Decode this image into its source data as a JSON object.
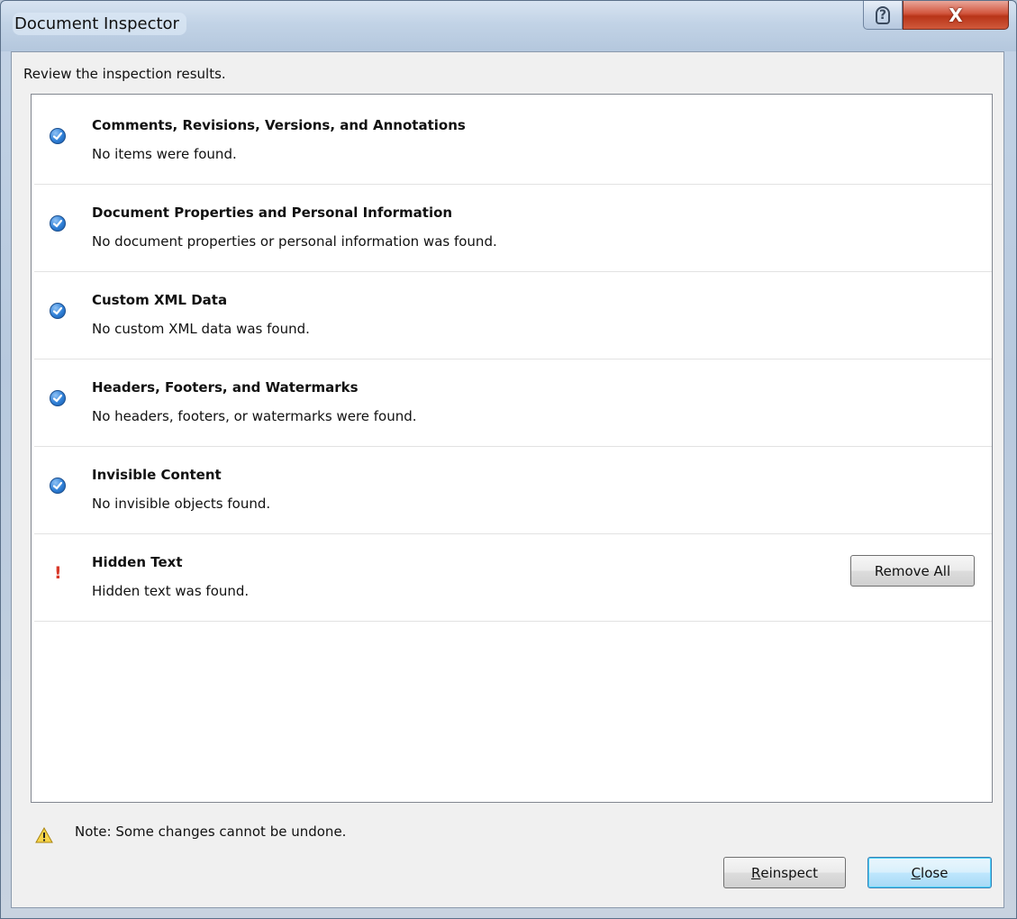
{
  "window": {
    "title": "Document Inspector",
    "help_glyph": "?",
    "close_glyph": "X"
  },
  "review_label": "Review the inspection results.",
  "results": [
    {
      "title": "Comments, Revisions, Versions, and Annotations",
      "description": "No items were found.",
      "status": "ok",
      "icon": "check-icon"
    },
    {
      "title": "Document Properties and Personal Information",
      "description": "No document properties or personal information was found.",
      "status": "ok",
      "icon": "check-icon"
    },
    {
      "title": "Custom XML Data",
      "description": "No custom XML data was found.",
      "status": "ok",
      "icon": "check-icon"
    },
    {
      "title": "Headers, Footers, and Watermarks",
      "description": "No headers, footers, or watermarks were found.",
      "status": "ok",
      "icon": "check-icon"
    },
    {
      "title": "Invisible Content",
      "description": "No invisible objects found.",
      "status": "ok",
      "icon": "check-icon"
    },
    {
      "title": "Hidden Text",
      "description": "Hidden text was found.",
      "status": "found",
      "icon": "exclamation-icon",
      "action_label": "Remove All"
    }
  ],
  "note": "Note: Some changes cannot be undone.",
  "buttons": {
    "reinspect_first": "R",
    "reinspect_rest": "einspect",
    "close_first": "C",
    "close_rest": "lose"
  },
  "colors": {
    "ok_icon": "#2f7fd6",
    "warning_mark": "#d8392a",
    "close_accent": "#c7401f"
  }
}
